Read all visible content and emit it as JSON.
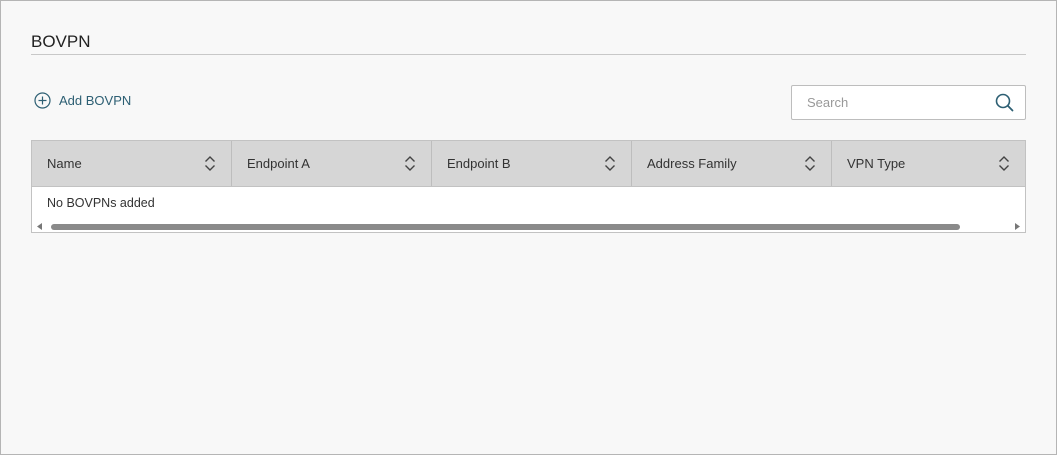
{
  "section": {
    "title": "BOVPN"
  },
  "toolbar": {
    "add_label": "Add BOVPN",
    "search_placeholder": "Search",
    "search_value": ""
  },
  "table": {
    "columns": [
      {
        "label": "Name"
      },
      {
        "label": "Endpoint A"
      },
      {
        "label": "Endpoint B"
      },
      {
        "label": "Address Family"
      },
      {
        "label": "VPN Type"
      }
    ],
    "empty_message": "No BOVPNs added"
  },
  "colors": {
    "accent": "#2d5f73",
    "header_bg": "#d6d6d6",
    "scroll_thumb": "#8a8a8a"
  }
}
